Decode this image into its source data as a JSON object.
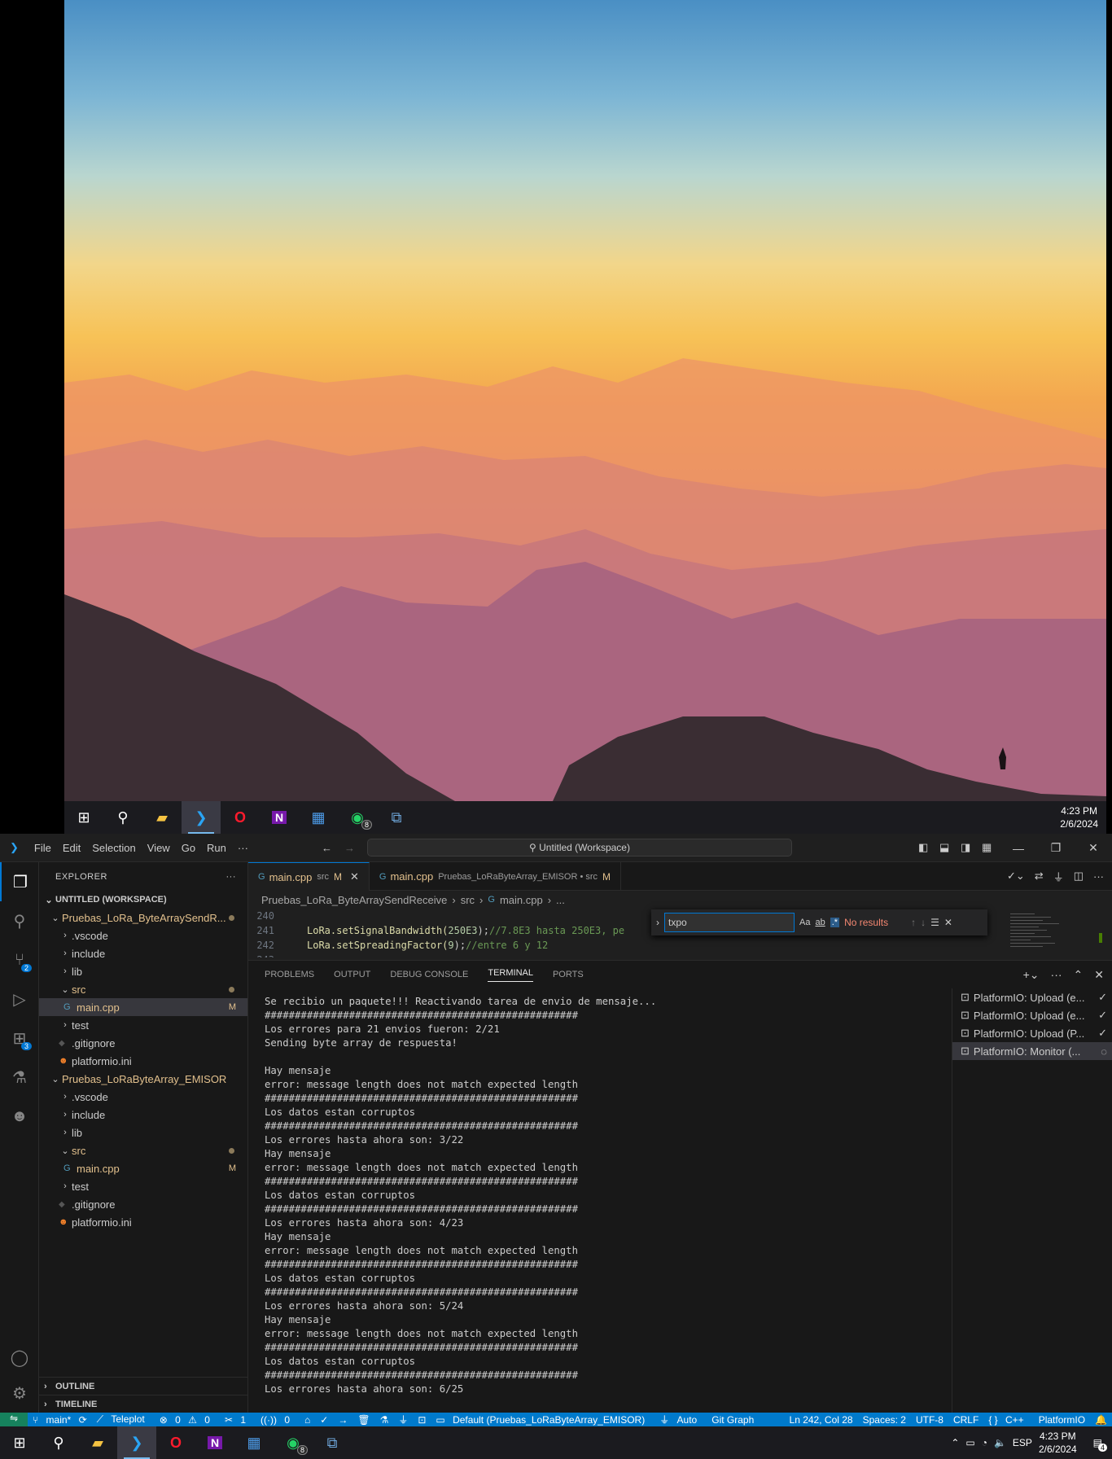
{
  "taskbar_top": {
    "clock_time": "4:23 PM",
    "clock_date": "2/6/2024",
    "whatsapp_badge": "8"
  },
  "titlebar": {
    "menus": [
      "File",
      "Edit",
      "Selection",
      "View",
      "Go",
      "Run",
      "···"
    ],
    "command_center": "Untitled (Workspace)"
  },
  "explorer": {
    "title": "EXPLORER",
    "workspace": "UNTITLED (WORKSPACE)",
    "folder1": "Pruebas_LoRa_ByteArraySendR...",
    "folder2": "Pruebas_LoRaByteArray_EMISOR",
    "items": {
      "vscode": ".vscode",
      "include": "include",
      "lib": "lib",
      "src": "src",
      "main": "main.cpp",
      "test": "test",
      "gitignore": ".gitignore",
      "platformio": "platformio.ini",
      "mod": "M"
    },
    "outline": "OUTLINE",
    "timeline": "TIMELINE"
  },
  "activity": {
    "scm_badge": "2",
    "ext_badge": "3"
  },
  "tabs": [
    {
      "label": "main.cpp",
      "desc": "src",
      "mark": "M"
    },
    {
      "label": "main.cpp",
      "desc": "Pruebas_LoRaByteArray_EMISOR • src",
      "mark": "M"
    }
  ],
  "breadcrumb": [
    "Pruebas_LoRa_ByteArraySendReceive",
    "src",
    "main.cpp",
    "..."
  ],
  "code": [
    {
      "n": "240",
      "text": ""
    },
    {
      "n": "241",
      "pre": "LoRa.setSignalBandwidth(",
      "num": "250E3",
      "post": ");",
      "comment": "//7.8E3 hasta 250E3, pe"
    },
    {
      "n": "242",
      "pre": "LoRa.setSpreadingFactor(",
      "num": "9",
      "post": ");",
      "comment": "//entre 6 y 12"
    },
    {
      "n": "243",
      "text": ""
    }
  ],
  "find": {
    "query": "txpo",
    "result": "No results"
  },
  "panel_tabs": [
    "PROBLEMS",
    "OUTPUT",
    "DEBUG CONSOLE",
    "TERMINAL",
    "PORTS"
  ],
  "terminal_lines": [
    "Se recibio un paquete!!! Reactivando tarea de envio de mensaje...",
    "####################################################",
    "Los errores para 21 envios fueron: 2/21",
    "Sending byte array de respuesta!",
    "",
    "Hay mensaje",
    "error: message length does not match expected length",
    "####################################################",
    "Los datos estan corruptos",
    "####################################################",
    "Los errores hasta ahora son: 3/22",
    "Hay mensaje",
    "error: message length does not match expected length",
    "####################################################",
    "Los datos estan corruptos",
    "####################################################",
    "Los errores hasta ahora son: 4/23",
    "Hay mensaje",
    "error: message length does not match expected length",
    "####################################################",
    "Los datos estan corruptos",
    "####################################################",
    "Los errores hasta ahora son: 5/24",
    "Hay mensaje",
    "error: message length does not match expected length",
    "####################################################",
    "Los datos estan corruptos",
    "####################################################",
    "Los errores hasta ahora son: 6/25"
  ],
  "terminals": [
    "PlatformIO: Upload (e...",
    "PlatformIO: Upload (e...",
    "PlatformIO: Upload (P...",
    "PlatformIO: Monitor (..."
  ],
  "status": {
    "branch": "main*",
    "teleplot": "Teleplot",
    "errors": "0",
    "warnings": "0",
    "ports": "1",
    "radio": "0",
    "env": "Default (Pruebas_LoRaByteArray_EMISOR)",
    "auto": "Auto",
    "gitgraph": "Git Graph",
    "pos": "Ln 242, Col 28",
    "spaces": "Spaces: 2",
    "enc": "UTF-8",
    "eol": "CRLF",
    "lang": "C++",
    "pio": "PlatformIO"
  },
  "taskbar_bottom": {
    "lang": "ESP",
    "clock_time": "4:23 PM",
    "clock_date": "2/6/2024",
    "notif": "4",
    "whatsapp_badge": "8"
  }
}
